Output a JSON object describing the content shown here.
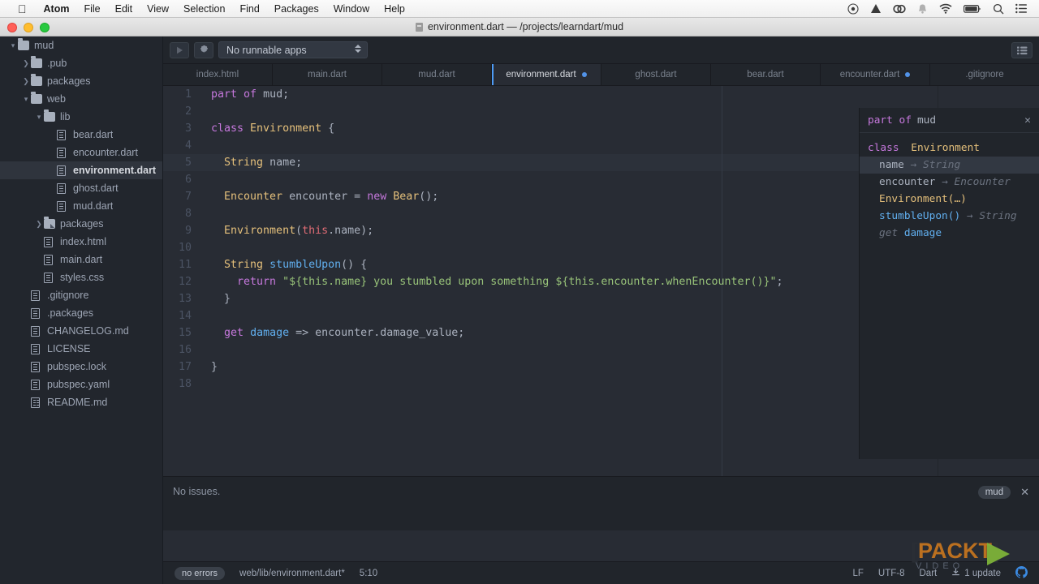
{
  "menubar": {
    "apple_icon": "apple-icon",
    "items": [
      "Atom",
      "File",
      "Edit",
      "View",
      "Selection",
      "Find",
      "Packages",
      "Window",
      "Help"
    ],
    "tray_icons": [
      "record-dot-icon",
      "google-drive-icon",
      "creative-cloud-icon",
      "bell-icon",
      "wifi-icon",
      "battery-charging-icon",
      "spotlight-search-icon",
      "notification-center-icon"
    ]
  },
  "window": {
    "title": "environment.dart — /projects/learndart/mud",
    "title_icon": "document-icon",
    "traffic_lights": [
      "close-button",
      "minimize-button",
      "zoom-button"
    ]
  },
  "toolbar": {
    "run_icon": "play-icon",
    "settings_icon": "gear-icon",
    "app_select_value": "No runnable apps",
    "toggle_outline_icon": "list-outline-icon"
  },
  "tabs": [
    {
      "label": "index.html",
      "active": false,
      "modified": false
    },
    {
      "label": "main.dart",
      "active": false,
      "modified": false
    },
    {
      "label": "mud.dart",
      "active": false,
      "modified": false
    },
    {
      "label": "environment.dart",
      "active": true,
      "modified": true
    },
    {
      "label": "ghost.dart",
      "active": false,
      "modified": false
    },
    {
      "label": "bear.dart",
      "active": false,
      "modified": false
    },
    {
      "label": "encounter.dart",
      "active": false,
      "modified": true
    },
    {
      "label": ".gitignore",
      "active": false,
      "modified": false
    }
  ],
  "tree": [
    {
      "name": "mud",
      "depth": 0,
      "type": "folder",
      "twisty": "down",
      "selected": false
    },
    {
      "name": ".pub",
      "depth": 1,
      "type": "folder",
      "twisty": "right",
      "selected": false
    },
    {
      "name": "packages",
      "depth": 1,
      "type": "folder",
      "twisty": "right",
      "selected": false
    },
    {
      "name": "web",
      "depth": 1,
      "type": "folder",
      "twisty": "down",
      "selected": false
    },
    {
      "name": "lib",
      "depth": 2,
      "type": "folder",
      "twisty": "down",
      "selected": false
    },
    {
      "name": "bear.dart",
      "depth": 3,
      "type": "file",
      "twisty": "",
      "selected": false
    },
    {
      "name": "encounter.dart",
      "depth": 3,
      "type": "file",
      "twisty": "",
      "selected": false
    },
    {
      "name": "environment.dart",
      "depth": 3,
      "type": "file",
      "twisty": "",
      "selected": true
    },
    {
      "name": "ghost.dart",
      "depth": 3,
      "type": "file",
      "twisty": "",
      "selected": false
    },
    {
      "name": "mud.dart",
      "depth": 3,
      "type": "file",
      "twisty": "",
      "selected": false
    },
    {
      "name": "packages",
      "depth": 2,
      "type": "folder-link",
      "twisty": "right",
      "selected": false
    },
    {
      "name": "index.html",
      "depth": 2,
      "type": "file",
      "twisty": "",
      "selected": false
    },
    {
      "name": "main.dart",
      "depth": 2,
      "type": "file",
      "twisty": "",
      "selected": false
    },
    {
      "name": "styles.css",
      "depth": 2,
      "type": "file",
      "twisty": "",
      "selected": false
    },
    {
      "name": ".gitignore",
      "depth": 1,
      "type": "file",
      "twisty": "",
      "selected": false
    },
    {
      "name": ".packages",
      "depth": 1,
      "type": "file",
      "twisty": "",
      "selected": false
    },
    {
      "name": "CHANGELOG.md",
      "depth": 1,
      "type": "file",
      "twisty": "",
      "selected": false
    },
    {
      "name": "LICENSE",
      "depth": 1,
      "type": "file",
      "twisty": "",
      "selected": false
    },
    {
      "name": "pubspec.lock",
      "depth": 1,
      "type": "file",
      "twisty": "",
      "selected": false
    },
    {
      "name": "pubspec.yaml",
      "depth": 1,
      "type": "file",
      "twisty": "",
      "selected": false
    },
    {
      "name": "README.md",
      "depth": 1,
      "type": "readme",
      "twisty": "",
      "selected": false
    }
  ],
  "editor": {
    "line_numbers": [
      "1",
      "2",
      "3",
      "4",
      "5",
      "6",
      "7",
      "8",
      "9",
      "10",
      "11",
      "12",
      "13",
      "14",
      "15",
      "16",
      "17",
      "18"
    ],
    "active_line": 5,
    "lines": [
      "part of mud;",
      "",
      "class Environment {",
      "",
      "  String name;",
      "",
      "  Encounter encounter = new Bear();",
      "",
      "  Environment(this.name);",
      "",
      "  String stumbleUpon() {",
      "    return \"${this.name} you stumbled upon something ${this.encounter.whenEncounter()}\";",
      "  }",
      "",
      "  get damage => encounter.damage_value;",
      "",
      "}",
      ""
    ]
  },
  "outline": {
    "header": "part of mud",
    "header_keyword": "part of",
    "header_name": "mud",
    "close_icon": "close-icon",
    "class_keyword": "class",
    "class_name": "Environment",
    "members": [
      {
        "name": "name",
        "arrow": "→",
        "type": "String",
        "highlighted": true,
        "style": "field"
      },
      {
        "name": "encounter",
        "arrow": "→",
        "type": "Encounter",
        "highlighted": false,
        "style": "field"
      },
      {
        "name": "Environment(…)",
        "arrow": "",
        "type": "",
        "highlighted": false,
        "style": "ctor"
      },
      {
        "name": "stumbleUpon()",
        "arrow": "→",
        "type": "String",
        "highlighted": false,
        "style": "method"
      },
      {
        "name": "damage",
        "arrow": "",
        "type": "",
        "highlighted": false,
        "style": "getter",
        "prefix": "get"
      }
    ]
  },
  "issues_panel": {
    "text": "No issues.",
    "badge": "mud",
    "close_icon": "close-icon"
  },
  "statusbar": {
    "errors_badge": "no errors",
    "file_path": "web/lib/environment.dart*",
    "cursor_position": "5:10",
    "line_ending": "LF",
    "encoding": "UTF-8",
    "grammar": "Dart",
    "updates": "1 update",
    "update_icon": "download-update-icon",
    "github_icon": "octocat-icon"
  },
  "watermark": {
    "brand": "PACKT",
    "sub": "VIDEO",
    "bracket_left": "[",
    "bracket_right": "]",
    "play_icon": "play-triangle-icon"
  },
  "colors": {
    "accent": "#4d9bf5",
    "keyword": "#c678dd",
    "type": "#e5c07b",
    "function": "#61afef",
    "string": "#98c379",
    "this": "#e06c75",
    "bg": "#282c34",
    "chrome": "#21252b",
    "sidebar": "#22262d"
  }
}
